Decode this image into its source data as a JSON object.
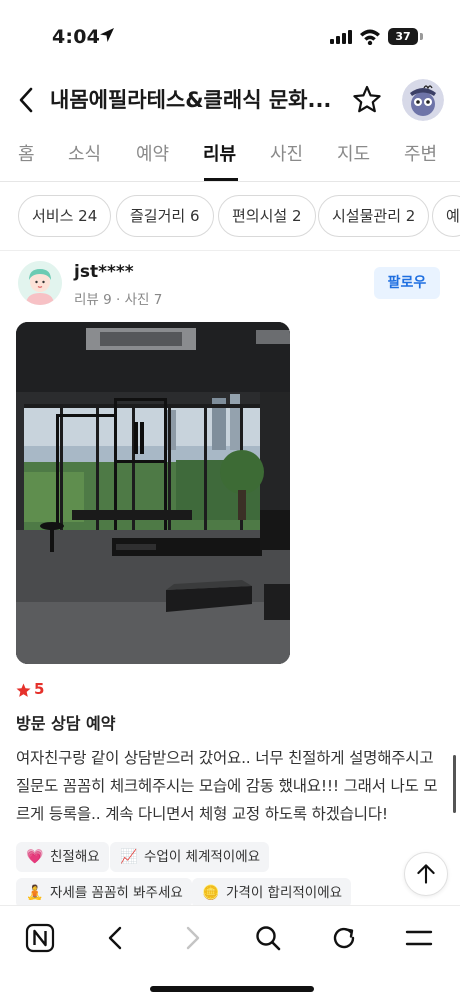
{
  "status_bar": {
    "time": "4:04",
    "battery": "37"
  },
  "header": {
    "title": "내몸에필라테스&클래식 문화..."
  },
  "tabs": [
    {
      "label": "홈",
      "active": false
    },
    {
      "label": "소식",
      "active": false
    },
    {
      "label": "예약",
      "active": false
    },
    {
      "label": "리뷰",
      "active": true
    },
    {
      "label": "사진",
      "active": false
    },
    {
      "label": "지도",
      "active": false
    },
    {
      "label": "주변",
      "active": false
    }
  ],
  "filters": [
    {
      "label": "서비스 24"
    },
    {
      "label": "즐길거리 6"
    },
    {
      "label": "편의시설 2"
    },
    {
      "label": "시설물관리 2"
    },
    {
      "label": "예"
    }
  ],
  "review": {
    "author": "jst****",
    "meta": "리뷰 9 · 사진 7",
    "follow_label": "팔로우",
    "rating": "5",
    "title": "방문 상담 예약",
    "body": "여자친구랑 같이 상담받으러 갔어요.. 너무 친절하게 설명해주시고 질문도 꼼꼼히 체크헤주시는 모습에 감동 했내요!!! 그래서 나도 모르게 등록을.. 계속 다니면서 체형 교정 하도록 하겠습니다!",
    "tags": [
      {
        "icon": "heart-icon",
        "label": "친절해요"
      },
      {
        "icon": "chart-icon",
        "label": "수업이 체계적이에요"
      },
      {
        "icon": "stretch-icon",
        "label": "자세를 꼼꼼히 봐주세요"
      },
      {
        "icon": "coins-icon",
        "label": "가격이 합리적이에요"
      }
    ]
  },
  "colors": {
    "accent_red": "#e5312b",
    "follow_blue": "#1f6fe0",
    "follow_bg": "#e9f3ff"
  }
}
